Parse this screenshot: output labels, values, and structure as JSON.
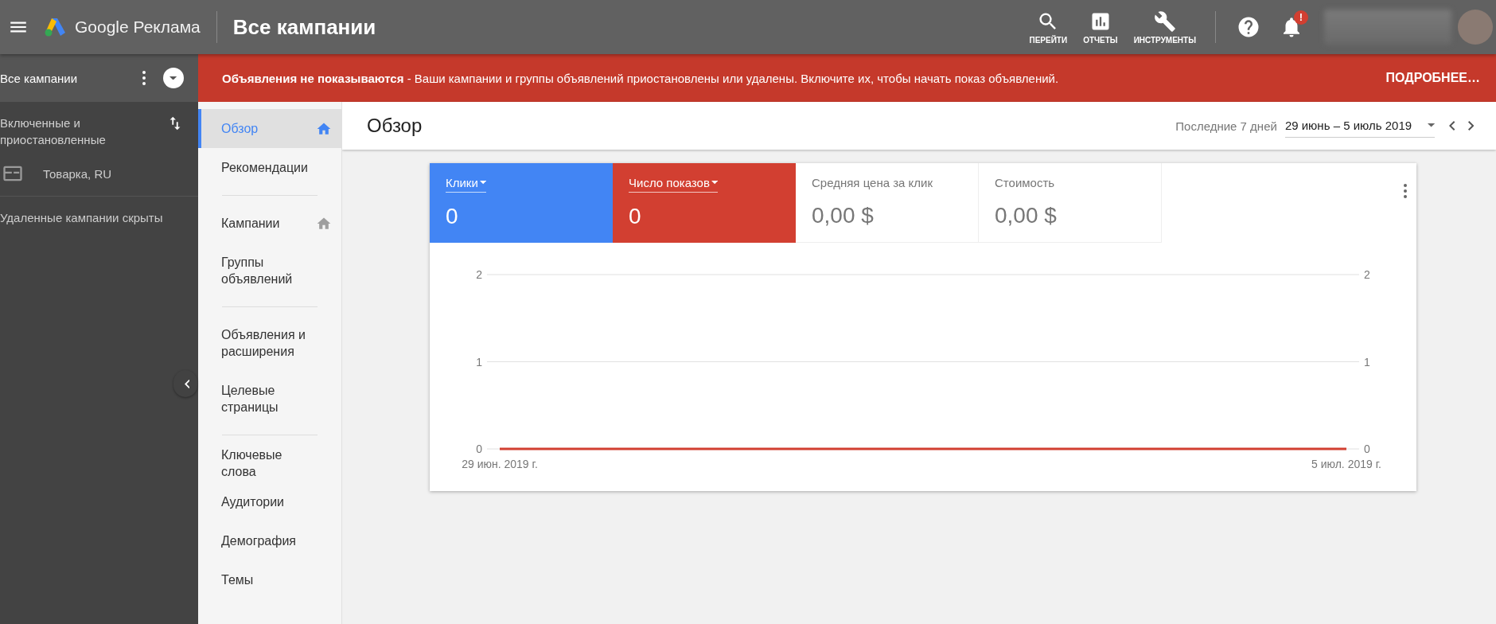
{
  "topbar": {
    "product": "Google Реклама",
    "title": "Все кампании",
    "tools": [
      {
        "label": "ПЕРЕЙТИ",
        "kind": "search"
      },
      {
        "label": "ОТЧЕТЫ",
        "kind": "reports"
      },
      {
        "label": "ИНСТРУМЕНТЫ",
        "kind": "tools"
      }
    ],
    "notification_badge": "!"
  },
  "sidebar": {
    "header": "Все кампании",
    "filter": "Включенные и приостановленные",
    "campaigns": [
      {
        "name": "Товарка, RU"
      }
    ],
    "footer": "Удаленные кампании скрыты"
  },
  "banner": {
    "message": "**Объявления не показываются** - Ваши кампании и группы объявлений приостановлены или удалены. Включите их, чтобы начать показ объявлений.",
    "link": "ПОДРОБНЕЕ…"
  },
  "nav": {
    "sections": [
      [
        {
          "label": "Обзор",
          "selected": true,
          "home": true
        },
        {
          "label": "Рекомендации",
          "selected": false,
          "home": false
        }
      ],
      [
        {
          "label": "Кампании",
          "selected": false,
          "home": true
        },
        {
          "label": "Группы объявлений",
          "selected": false,
          "home": false
        }
      ],
      [
        {
          "label": "Объявления и расширения",
          "selected": false,
          "home": false
        },
        {
          "label": "Целевые страницы",
          "selected": false,
          "home": false
        }
      ],
      [
        {
          "label": "Ключевые слова",
          "selected": false,
          "home": false
        },
        {
          "label": "Аудитории",
          "selected": false,
          "home": false
        },
        {
          "label": "Демография",
          "selected": false,
          "home": false
        },
        {
          "label": "Темы",
          "selected": false,
          "home": false
        }
      ]
    ]
  },
  "page": {
    "title": "Обзор",
    "range_label": "Последние 7 дней",
    "date_range": "29 июнь – 5 июль 2019"
  },
  "metrics": [
    {
      "label": "Клики",
      "value": "0",
      "selected": true,
      "color": "#4285f4"
    },
    {
      "label": "Число показов",
      "value": "0",
      "selected": true,
      "color": "#d23f31"
    },
    {
      "label": "Средняя цена за клик",
      "value": "0,00 $",
      "selected": false,
      "color": "#ffffff"
    },
    {
      "label": "Стоимость",
      "value": "0,00 $",
      "selected": false,
      "color": "#ffffff"
    }
  ],
  "chart_data": {
    "type": "line",
    "categories": [
      "29 июн. 2019 г.",
      "5 июл. 2019 г."
    ],
    "series": [
      {
        "color": "#d23f31",
        "values": [
          0,
          0
        ]
      }
    ],
    "ylim": [
      0,
      2
    ],
    "yticks": [
      0,
      1,
      2
    ]
  },
  "right_axis_labels": [
    "2",
    "1",
    "0"
  ]
}
